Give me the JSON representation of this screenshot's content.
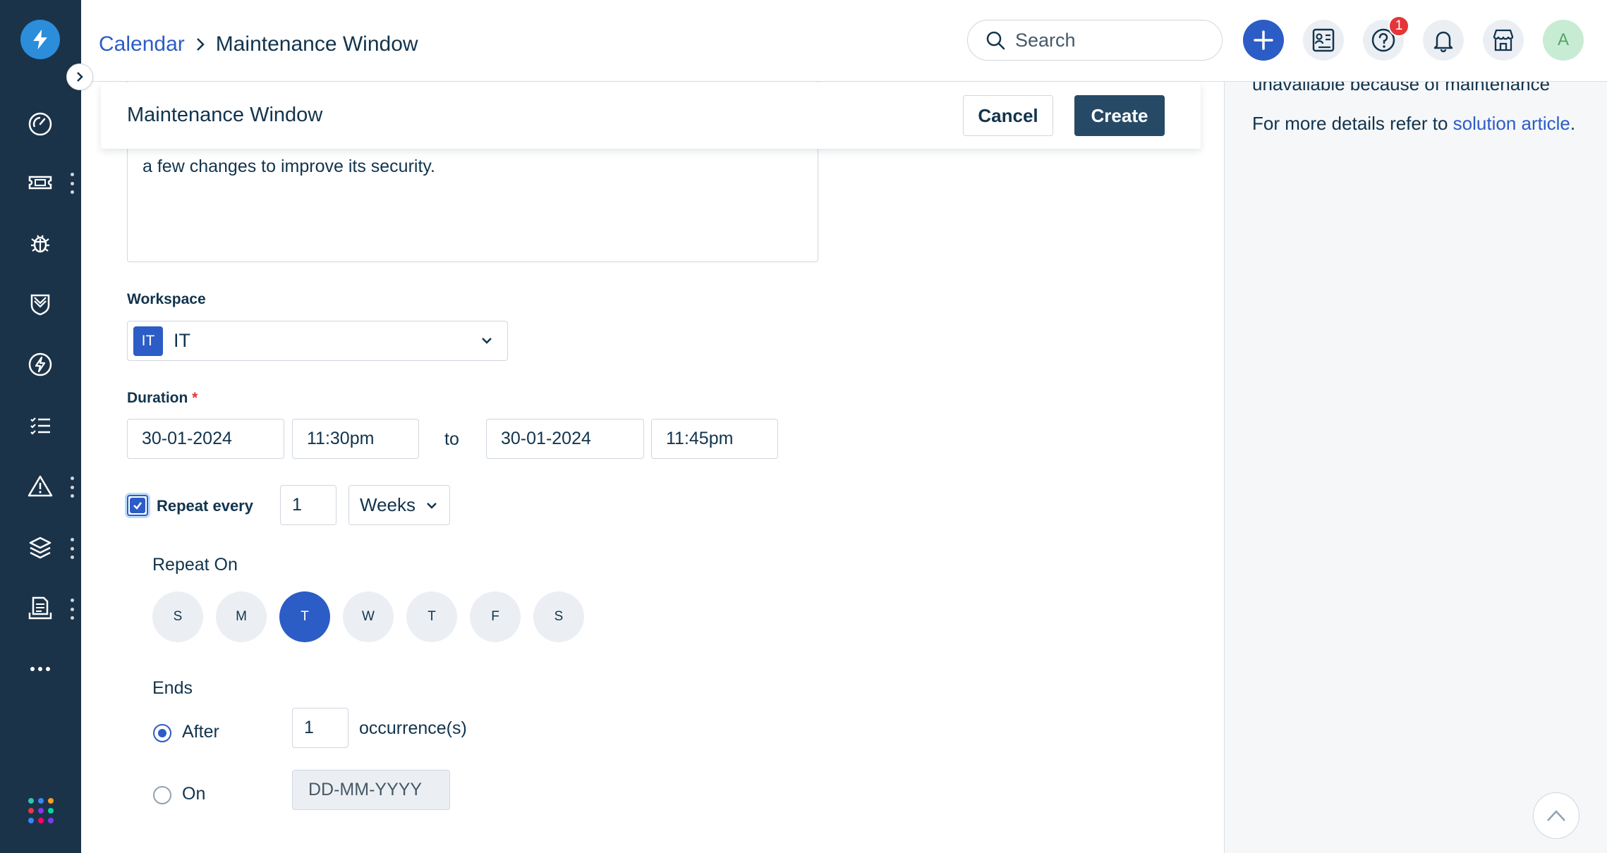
{
  "header": {
    "breadcrumb_parent": "Calendar",
    "breadcrumb_current": "Maintenance Window",
    "search_placeholder": "Search",
    "help_badge": "1",
    "avatar_initial": "A"
  },
  "form_header": {
    "title": "Maintenance Window",
    "cancel_label": "Cancel",
    "create_label": "Create"
  },
  "form": {
    "description_visible": "a few changes to improve its security.",
    "workspace_label": "Workspace",
    "workspace_chip": "IT",
    "workspace_value": "IT",
    "duration_label": "Duration",
    "required_mark": "*",
    "start_date": "30-01-2024",
    "start_time": "11:30pm",
    "to_text": "to",
    "end_date": "30-01-2024",
    "end_time": "11:45pm",
    "repeat_label": "Repeat every",
    "repeat_checked": true,
    "repeat_interval": "1",
    "repeat_unit": "Weeks",
    "repeat_on_label": "Repeat On",
    "days": [
      "S",
      "M",
      "T",
      "W",
      "T",
      "F",
      "S"
    ],
    "selected_day_index": 2,
    "ends_label": "Ends",
    "after_label": "After",
    "after_selected": true,
    "occurrences_value": "1",
    "occurrences_text": "occurrence(s)",
    "on_label": "On",
    "on_date_placeholder": "DD-MM-YYYY"
  },
  "right_panel": {
    "text_cut": "unavailable because of maintenance",
    "details_prefix": "For more details refer to ",
    "details_link": "solution article",
    "details_suffix": "."
  },
  "colors": {
    "sidebar": "#1b3349",
    "accent": "#2c5cc5",
    "create_button": "#264966",
    "badge": "#e43538"
  },
  "sidebar": {
    "items": [
      "dashboard-icon",
      "tickets-icon",
      "problems-icon",
      "changes-icon",
      "releases-icon",
      "tasks-icon",
      "alerts-icon",
      "assets-icon",
      "reports-icon",
      "more-icon"
    ]
  }
}
